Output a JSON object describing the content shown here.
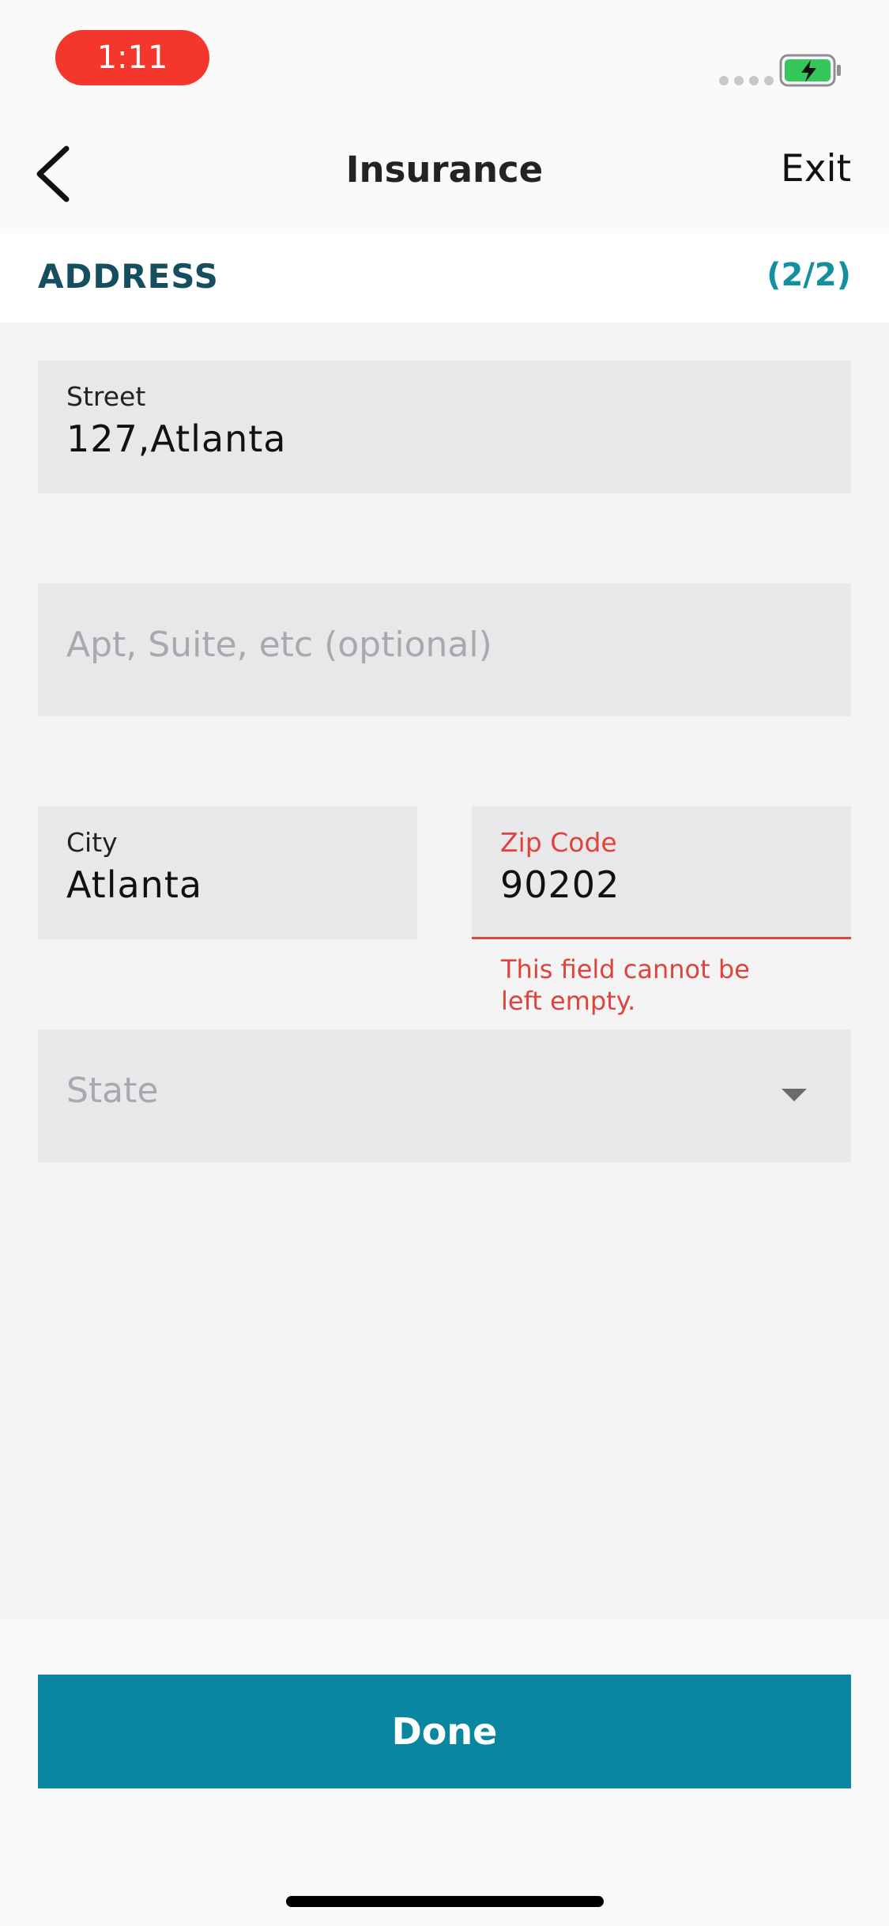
{
  "status_bar": {
    "time": "1:11",
    "time_pill_color": "#f4372d",
    "battery_color": "#34c759"
  },
  "nav": {
    "back_icon": "chevron-left-icon",
    "title": "Insurance",
    "exit_label": "Exit"
  },
  "section": {
    "title": "ADDRESS",
    "step": "(2/2)"
  },
  "form": {
    "street": {
      "label": "Street",
      "value": "127,Atlanta"
    },
    "apt": {
      "placeholder": "Apt, Suite, etc (optional)"
    },
    "city": {
      "label": "City",
      "value": "Atlanta"
    },
    "zip": {
      "label": "Zip Code",
      "value": "90202",
      "error": "This field cannot be left empty."
    },
    "state": {
      "placeholder": "State",
      "icon": "caret-down-icon"
    }
  },
  "footer": {
    "done_label": "Done",
    "button_color": "#0b86a0"
  }
}
